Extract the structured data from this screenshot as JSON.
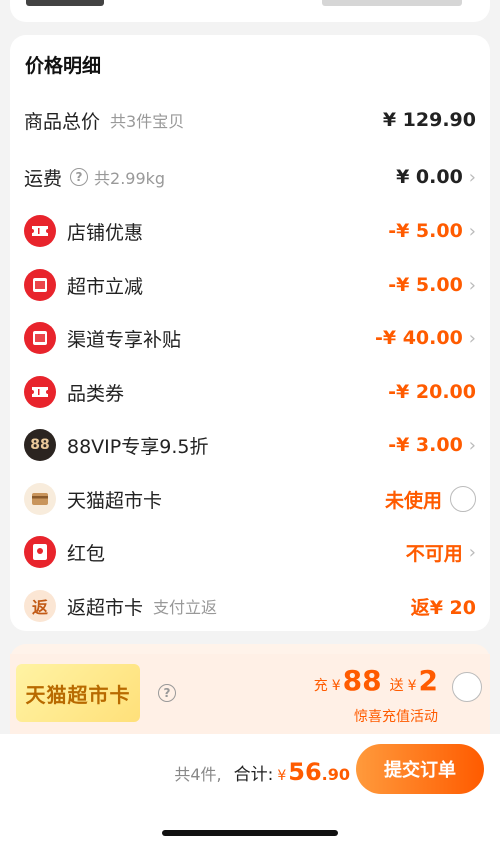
{
  "price_detail": {
    "title": "价格明细",
    "rows": [
      {
        "label": "商品总价",
        "sub": "共3件宝贝",
        "value": "¥ 129.90"
      },
      {
        "label": "运费",
        "sub": "共2.99kg",
        "value": "¥ 0.00"
      },
      {
        "label": "店铺优惠",
        "value": "-¥ 5.00"
      },
      {
        "label": "超市立减",
        "value": "-¥ 5.00"
      },
      {
        "label": "渠道专享补贴",
        "value": "-¥ 40.00"
      },
      {
        "label": "品类券",
        "value": "-¥ 20.00"
      },
      {
        "label": "88VIP专享9.5折",
        "value": "-¥ 3.00",
        "icon_text": "88"
      },
      {
        "label": "天猫超市卡",
        "value": "未使用"
      },
      {
        "label": "红包",
        "value": "不可用"
      },
      {
        "label": "返超市卡",
        "sub": "支付立返",
        "value": "返¥ 20",
        "icon_text": "返"
      }
    ]
  },
  "promo": {
    "card_label": "天猫超市卡",
    "charge": "充",
    "yen1": "¥",
    "amount1": "88",
    "give": "送",
    "yen2": "¥",
    "amount2": "2",
    "subtitle": "惊喜充值活动"
  },
  "bottom": {
    "count": "共4件,",
    "total_label": "合计:",
    "yen": "¥",
    "total_int": "56",
    "total_dec": ".90",
    "submit": "提交订单"
  },
  "colors": {
    "accent": "#ff5b00",
    "red_icon": "#e8242c"
  }
}
